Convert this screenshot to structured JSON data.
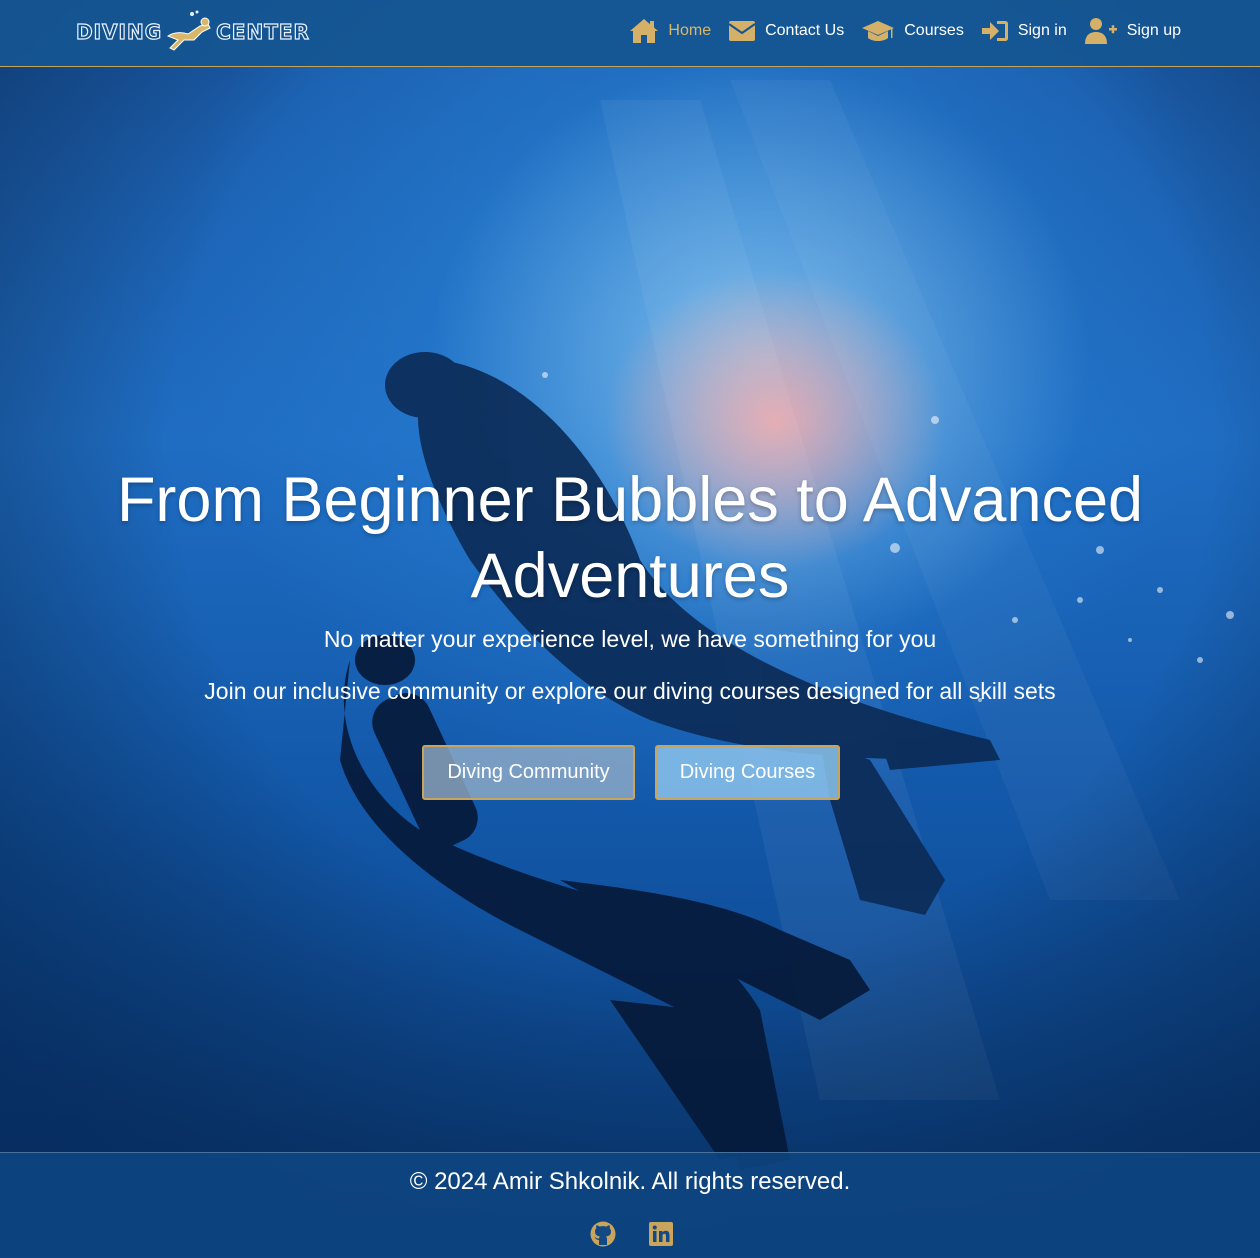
{
  "brand": {
    "word1": "DIVING",
    "word2": "CENTER"
  },
  "nav": [
    {
      "label": "Home",
      "icon": "home-icon",
      "active": true
    },
    {
      "label": "Contact Us",
      "icon": "envelope-icon"
    },
    {
      "label": "Courses",
      "icon": "graduation-cap-icon"
    },
    {
      "label": "Sign in",
      "icon": "sign-in-icon"
    },
    {
      "label": "Sign up",
      "icon": "user-plus-icon"
    }
  ],
  "hero": {
    "title_line1": "From Beginner Bubbles to Advanced",
    "title_line2": "Adventures",
    "subtitle": "No matter your experience level, we have something for you",
    "subtitle2": "Join our inclusive community or explore our diving courses designed for all skill sets",
    "buttons": {
      "community": "Diving Community",
      "courses": "Diving Courses"
    }
  },
  "footer": {
    "copyright": "© 2024 Amir Shkolnik. All rights reserved.",
    "social": [
      "github-icon",
      "linkedin-icon"
    ]
  },
  "colors": {
    "accent": "#c9a45c",
    "header_bg": "#145591",
    "ocean": "#1f6dc3"
  }
}
